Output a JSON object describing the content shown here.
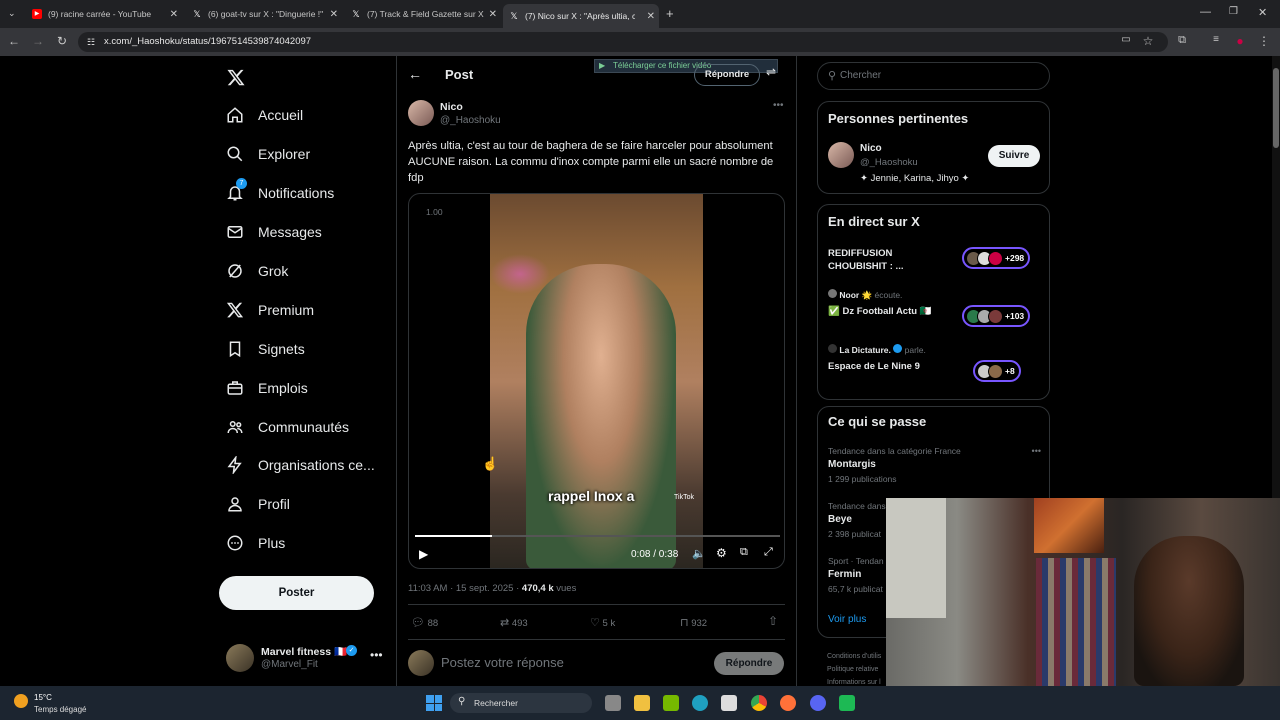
{
  "browser": {
    "tabs": [
      {
        "label": "(9) racine carrée - YouTube",
        "icon": "youtube-icon"
      },
      {
        "label": "(6) goat-tv sur X : \"Dinguerie !\"",
        "icon": "x-icon"
      },
      {
        "label": "(7) Track & Field Gazette sur X",
        "icon": "x-icon"
      },
      {
        "label": "(7) Nico sur X : \"Après ultia, c'es",
        "icon": "x-icon"
      }
    ],
    "url": "x.com/_Haoshoku/status/1967514539874042097"
  },
  "nav": {
    "items": [
      {
        "label": "Accueil",
        "icon": "home-icon"
      },
      {
        "label": "Explorer",
        "icon": "search-icon"
      },
      {
        "label": "Notifications",
        "icon": "bell-icon",
        "badge": "7"
      },
      {
        "label": "Messages",
        "icon": "mail-icon"
      },
      {
        "label": "Grok",
        "icon": "grok-icon"
      },
      {
        "label": "Premium",
        "icon": "x-logo-icon"
      },
      {
        "label": "Signets",
        "icon": "bookmark-icon"
      },
      {
        "label": "Emplois",
        "icon": "briefcase-icon"
      },
      {
        "label": "Communautés",
        "icon": "people-icon"
      },
      {
        "label": "Organisations ce...",
        "icon": "bolt-icon"
      },
      {
        "label": "Profil",
        "icon": "person-icon"
      },
      {
        "label": "Plus",
        "icon": "more-circle-icon"
      }
    ],
    "post_button": "Poster",
    "account": {
      "name": "Marvel fitness 🇫🇷",
      "handle": "@Marvel_Fit"
    }
  },
  "post": {
    "header_title": "Post",
    "reply_button": "Répondre",
    "download_overlay": "Télécharger ce fichier vidéo",
    "author": {
      "name": "Nico",
      "handle": "@_Haoshoku"
    },
    "text": "Après ultia, c'est au tour de baghera de se faire harceler pour absolument AUCUNE raison. La commu d'inox compte parmi elle un sacré nombre de fdp",
    "video": {
      "speed": "1.00",
      "caption": "rappel Inox a",
      "time": "0:08 / 0:38",
      "progress": 0.21,
      "watermark": "TikTok"
    },
    "meta": {
      "time": "11:03 AM · 15 sept. 2025 · ",
      "views": "470,4 k",
      "views_label": " vues"
    },
    "stats": {
      "replies": "88",
      "reposts": "493",
      "likes": "5 k",
      "bookmarks": "932"
    },
    "reply_placeholder": "Postez votre réponse",
    "reply_submit": "Répondre"
  },
  "sidebar": {
    "search_placeholder": "Chercher",
    "relevant": {
      "title": "Personnes pertinentes",
      "name": "Nico",
      "handle": "@_Haoshoku",
      "bio": "✦ Jennie, Karina, Jihyo ✦",
      "follow": "Suivre"
    },
    "live": {
      "title": "En direct sur X",
      "items": [
        {
          "host": "",
          "status": "",
          "title": "REDIFFUSION CHOUBISHIT : ...",
          "count": "+298"
        },
        {
          "host": "Noor 🌟",
          "status": "écoute.",
          "title": "✅ Dz Football Actu 🇩🇿",
          "count": "+103"
        },
        {
          "host": "La Dictature.",
          "status": "parle.",
          "title": "Espace de Le Nine 9",
          "count": "+8"
        }
      ]
    },
    "trends": {
      "title": "Ce qui se passe",
      "items": [
        {
          "context": "Tendance dans la catégorie France",
          "name": "Montargis",
          "count": "1 299 publications"
        },
        {
          "context": "Tendance dans",
          "name": "Beye",
          "count": "2 398 publicat"
        },
        {
          "context": "Sport · Tendan",
          "name": "Fermin",
          "count": "65,7 k publicat"
        }
      ],
      "see_more": "Voir plus"
    },
    "footer": [
      "Conditions d'utilis",
      "Politique relative",
      "Informations sur l"
    ]
  },
  "taskbar": {
    "weather_temp": "15°C",
    "weather_desc": "Temps dégagé",
    "search": "Rechercher"
  },
  "colors": {
    "accent": "#1d9bf0",
    "live": "#7856ff",
    "background": "#000000"
  }
}
